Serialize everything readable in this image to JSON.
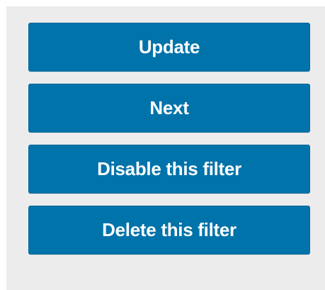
{
  "actions": {
    "update_label": "Update",
    "next_label": "Next",
    "disable_label": "Disable this filter",
    "delete_label": "Delete this filter"
  },
  "colors": {
    "button_background": "#0073aa",
    "button_text": "#ffffff",
    "panel_background": "#ececec"
  }
}
